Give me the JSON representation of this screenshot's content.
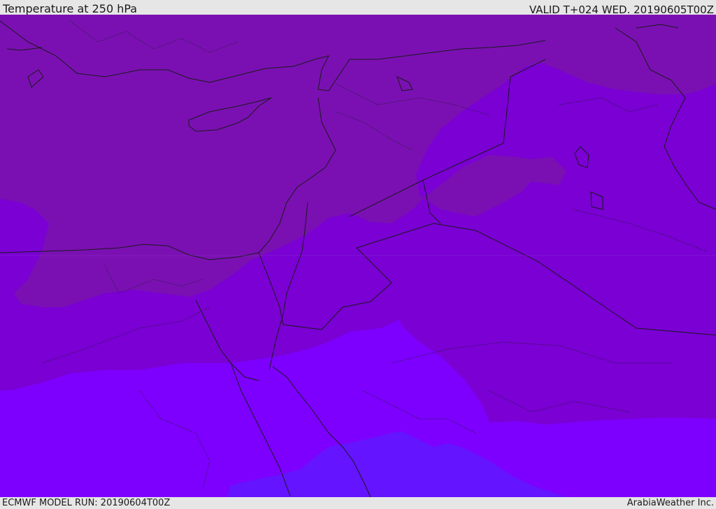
{
  "header": {
    "title": "Temperature at 250 hPa",
    "valid": "VALID T+024 WED. 20190605T00Z"
  },
  "footer": {
    "model_run": "ECMWF MODEL RUN: 20190604T00Z",
    "credit": "ArabiaWeather Inc."
  },
  "map": {
    "field": "temperature",
    "level": "250 hPa",
    "colors": {
      "band_warmest": "#7a10b2",
      "band_warm": "#7a00d4",
      "band_mid": "#7d00ff",
      "band_cool": "#6414ff",
      "coastline": "#1a1a1a",
      "border": "#1a1a1a"
    }
  }
}
